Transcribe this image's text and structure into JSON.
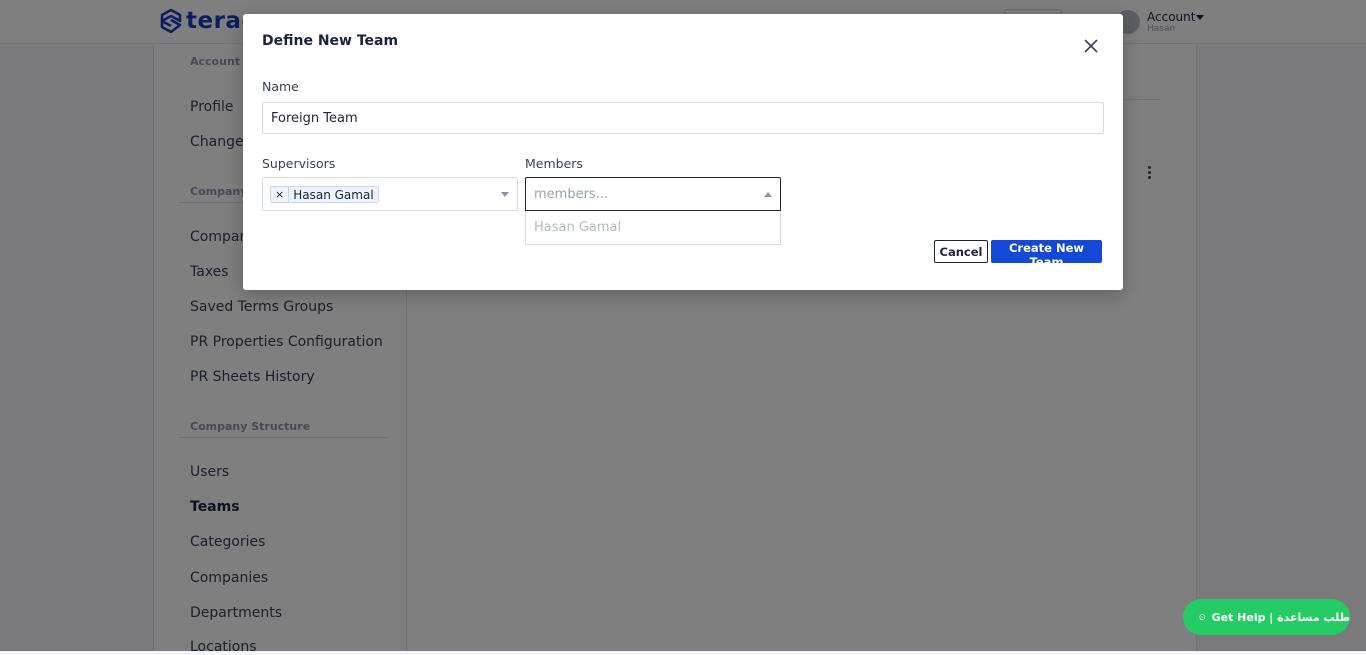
{
  "app": {
    "logo_text": "terac",
    "account_label": "Account",
    "account_sub": "Hasan"
  },
  "sidebar": {
    "sections": [
      {
        "label": "Account s"
      },
      {
        "label": "Company"
      },
      {
        "label": "Company Structure"
      }
    ],
    "items": [
      {
        "label": "Profile"
      },
      {
        "label": "Change P"
      },
      {
        "label": "Company"
      },
      {
        "label": "Taxes"
      },
      {
        "label": "Saved Terms Groups"
      },
      {
        "label": "PR Properties Configuration"
      },
      {
        "label": "PR Sheets History"
      },
      {
        "label": "Users"
      },
      {
        "label": "Teams"
      },
      {
        "label": "Categories"
      },
      {
        "label": "Companies"
      },
      {
        "label": "Departments"
      },
      {
        "label": "Locations"
      }
    ],
    "active_item": "Teams"
  },
  "modal": {
    "title": "Define New Team",
    "name_label": "Name",
    "name_value": "Foreign Team",
    "supervisors_label": "Supervisors",
    "supervisors_selected": [
      "Hasan Gamal"
    ],
    "tag_remove": "×",
    "members_label": "Members",
    "members_placeholder": "members...",
    "members_options": [
      "Hasan Gamal"
    ],
    "cancel_label": "Cancel",
    "create_label": "Create New Team"
  },
  "help": {
    "label": "Get Help | طلب مساعدة",
    "icon": "whatsapp-icon",
    "color": "#25cc65"
  },
  "colors": {
    "primary": "#1448d6",
    "brand": "#1b3fbf"
  }
}
